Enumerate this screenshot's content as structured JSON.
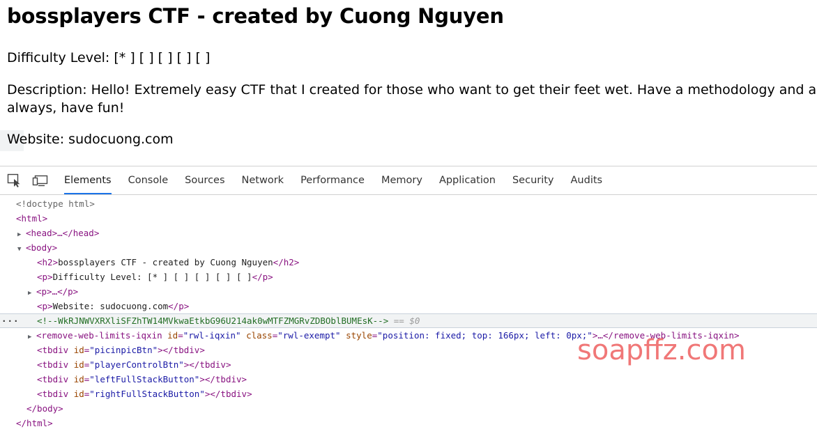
{
  "page": {
    "heading": "bossplayers CTF - created by Cuong Nguyen",
    "difficulty": "Difficulty Level: [* ] [ ] [ ] [ ] [ ]",
    "description": "Description: Hello! Extremely easy CTF that I created for those who want to get their feet wet. Have a methodology and as always, have fun!",
    "website": "Website: sudocuong.com"
  },
  "devtools": {
    "icons": [
      "inspect-element-icon",
      "device-toolbar-icon"
    ],
    "tabs": [
      "Elements",
      "Console",
      "Sources",
      "Network",
      "Performance",
      "Memory",
      "Application",
      "Security",
      "Audits"
    ],
    "active_tab": "Elements",
    "dom": {
      "doctype": "<!doctype html>",
      "html_open": "<html>",
      "head_collapsed": "<head>…</head>",
      "body_open": "<body>",
      "h2_open": "<h2>",
      "h2_text": "bossplayers CTF - created by Cuong Nguyen",
      "h2_close": "</h2>",
      "p_open": "<p>",
      "p_close": "</p>",
      "p1_text": "Difficulty Level: [* ] [ ] [ ] [ ] [ ]",
      "p2_collapsed": "<p>…</p>",
      "p3_text": "Website: sudocuong.com",
      "comment": "<!--WkRJNWVXRXliSFZhTW14MVkwaEtkbG96U214ak0wMTFZMGRvZDBOblBUMEsK-->",
      "comment_marker": "== $0",
      "selected_line_dots": "···",
      "rwl": {
        "open": "<remove-web-limits-iqxin",
        "attr_id": "id",
        "val_id": "\"rwl-iqxin\"",
        "attr_class": "class",
        "val_class": "\"rwl-exempt\"",
        "attr_style": "style",
        "val_style": "\"position: fixed; top: 166px; left: 0px;\"",
        "middle": ">…",
        "close": "</remove-web-limits-iqxin>"
      },
      "tbdiv_open": "<tbdiv",
      "tbdiv_close": "></tbdiv>",
      "tbdivs": [
        "\"picinpicBtn\"",
        "\"playerControlBtn\"",
        "\"leftFullStackButton\"",
        "\"rightFullStackButton\""
      ],
      "body_close": "</body>",
      "html_close": "</html>"
    }
  },
  "watermark": "soapffz.com"
}
